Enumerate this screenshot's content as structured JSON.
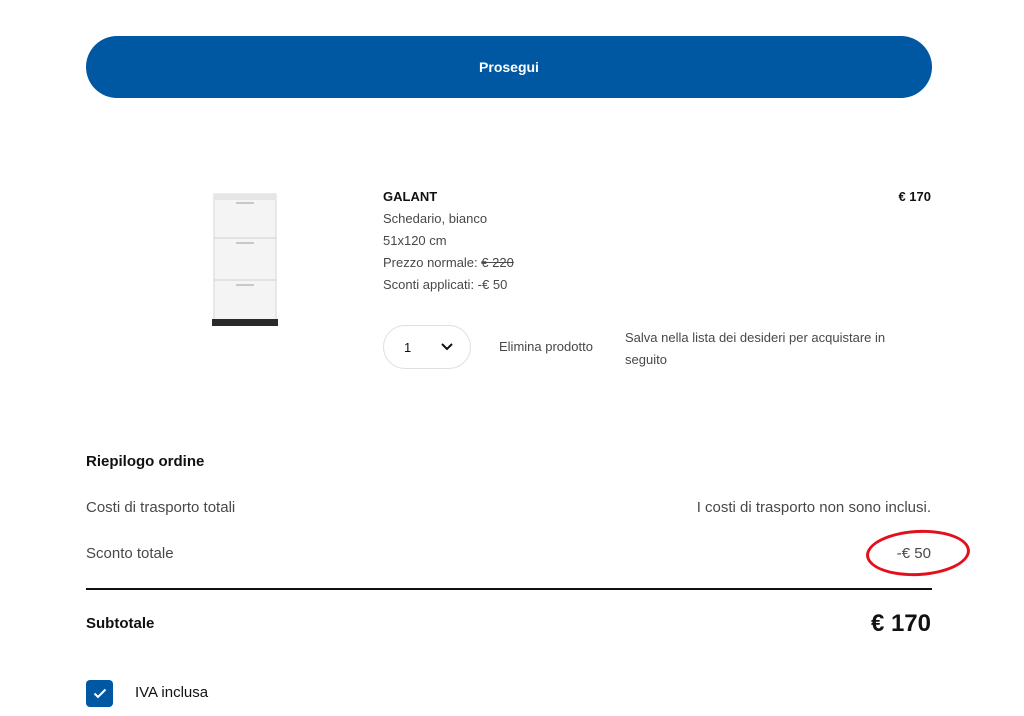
{
  "cart": {
    "continue_label": "Prosegui",
    "product": {
      "name": "GALANT",
      "price": "€ 170",
      "description": "Schedario, bianco",
      "size": "51x120 cm",
      "regular_price_label": "Prezzo normale: ",
      "regular_price_value": "€ 220",
      "discounts_label": "Sconti applicati: -€ 50",
      "image_icon": "filing-cabinet-icon"
    },
    "quantity": {
      "value": "1",
      "icon": "chevron-down-icon"
    },
    "remove_label": "Elimina prodotto",
    "save_label": "Salva nella lista dei desideri per acquistare in seguito"
  },
  "summary": {
    "title": "Riepilogo ordine",
    "shipping_label": "Costi di trasporto totali",
    "shipping_value": "I costi di trasporto non sono inclusi.",
    "discount_label": "Sconto totale",
    "discount_value": "-€ 50",
    "subtotal_label": "Subtotale",
    "subtotal_value": "€ 170",
    "vat_label": "IVA inclusa",
    "vat_checked": true
  },
  "colors": {
    "brand_blue": "#0058a3",
    "annotation_red": "#e3101b"
  }
}
